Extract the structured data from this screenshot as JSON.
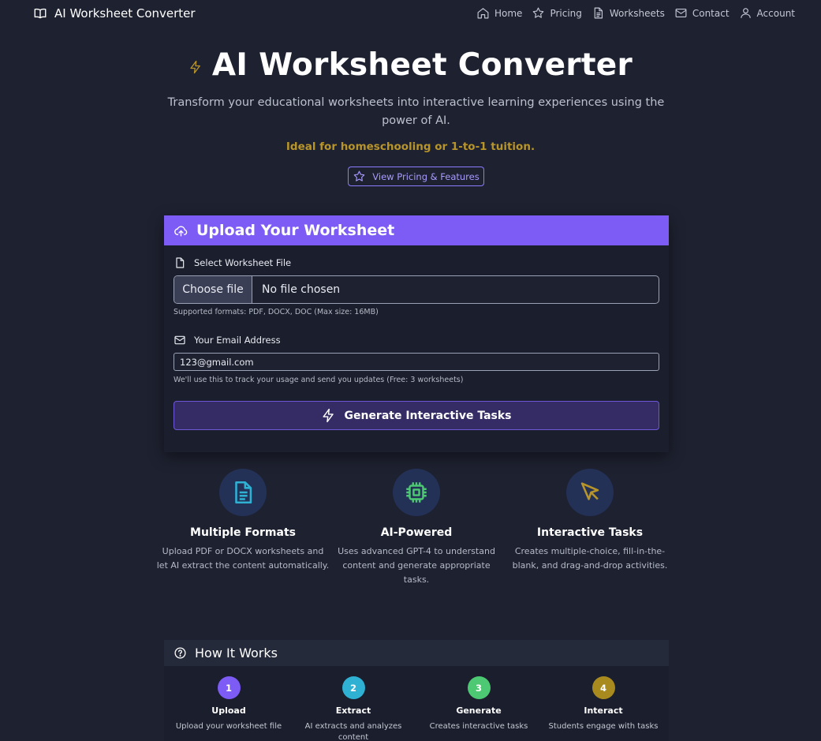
{
  "nav": {
    "brand": "AI Worksheet Converter",
    "links": [
      {
        "label": "Home",
        "icon": "home-icon"
      },
      {
        "label": "Pricing",
        "icon": "star-icon"
      },
      {
        "label": "Worksheets",
        "icon": "document-icon"
      },
      {
        "label": "Contact",
        "icon": "mail-icon"
      },
      {
        "label": "Account",
        "icon": "user-icon"
      }
    ]
  },
  "hero": {
    "title": "AI Worksheet Converter",
    "subtitle": "Transform your educational worksheets into interactive learning experiences using the power of AI.",
    "ideal": "Ideal for homeschooling or 1-to-1 tuition.",
    "pricing_button": "View Pricing & Features"
  },
  "upload": {
    "heading": "Upload Your Worksheet",
    "file_label": "Select Worksheet File",
    "choose_file": "Choose file",
    "no_file": "No file chosen",
    "file_hint": "Supported formats: PDF, DOCX, DOC (Max size: 16MB)",
    "email_label": "Your Email Address",
    "email_value": "123@gmail.com",
    "email_hint": "We'll use this to track your usage and send you updates (Free: 3 worksheets)",
    "generate_button": "Generate Interactive Tasks"
  },
  "features": [
    {
      "title": "Multiple Formats",
      "desc": "Upload PDF or DOCX worksheets and let AI extract the content automatically.",
      "icon": "document-text-icon"
    },
    {
      "title": "AI-Powered",
      "desc": "Uses advanced GPT-4 to understand content and generate appropriate tasks.",
      "icon": "cpu-chip-icon"
    },
    {
      "title": "Interactive Tasks",
      "desc": "Creates multiple-choice, fill-in-the-blank, and drag-and-drop activities.",
      "icon": "cursor-pointer-icon"
    }
  ],
  "how": {
    "heading": "How It Works",
    "steps": [
      {
        "num": "1",
        "title": "Upload",
        "desc": "Upload your worksheet file"
      },
      {
        "num": "2",
        "title": "Extract",
        "desc": "AI extracts and analyzes content"
      },
      {
        "num": "3",
        "title": "Generate",
        "desc": "Creates interactive tasks"
      },
      {
        "num": "4",
        "title": "Interact",
        "desc": "Students engage with tasks"
      }
    ]
  },
  "colors": {
    "background": "#1e2130",
    "accent_purple": "#7c5cf5",
    "gold": "#b8952a",
    "step_1": "#7c5cf5",
    "step_2": "#2fb1d4",
    "step_3": "#4cc972",
    "step_4": "#a88a1f"
  }
}
